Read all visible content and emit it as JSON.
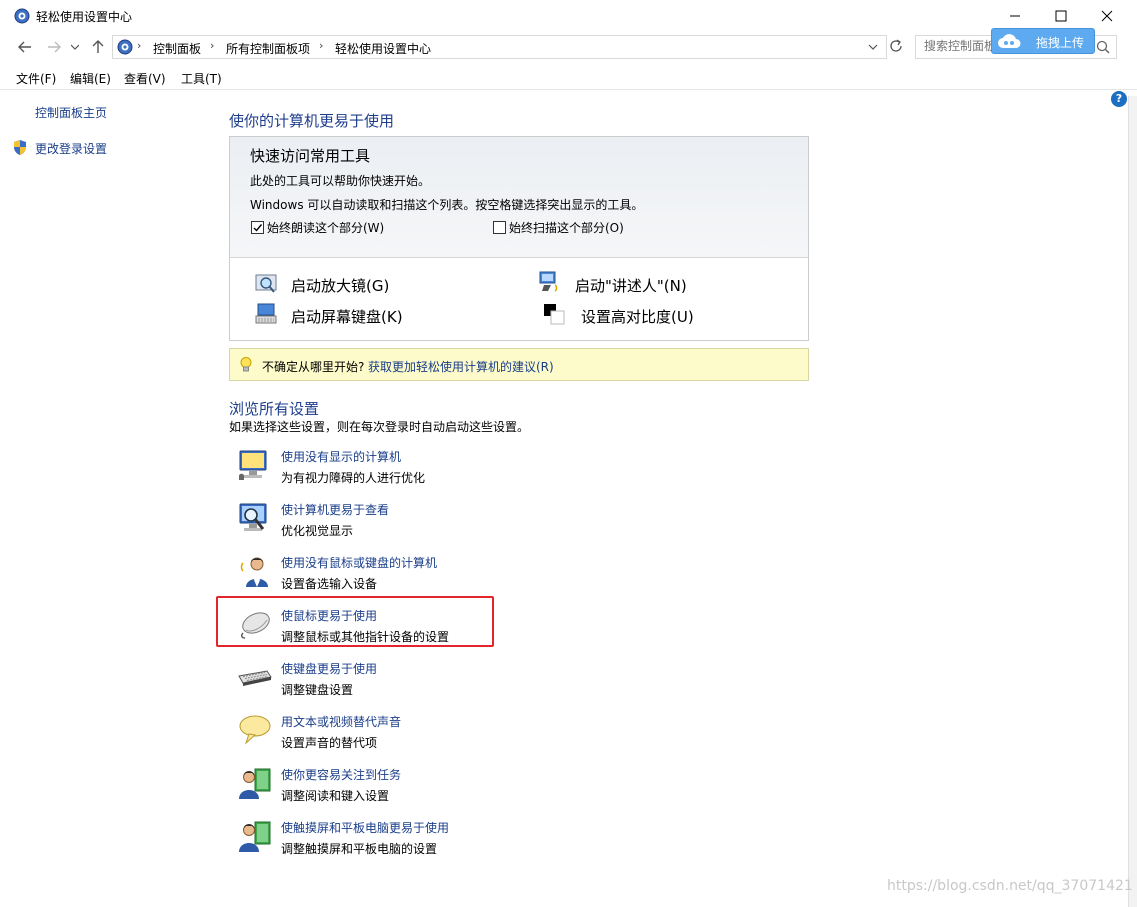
{
  "window": {
    "title": "轻松使用设置中心",
    "controls": [
      "minimize",
      "maximize",
      "close"
    ]
  },
  "address": {
    "breadcrumbs": [
      "控制面板",
      "所有控制面板项",
      "轻松使用设置中心"
    ],
    "search_placeholder": "搜索控制面板"
  },
  "upload_widget": {
    "label": "拖拽上传"
  },
  "menu": [
    {
      "label": "文件(F)"
    },
    {
      "label": "编辑(E)"
    },
    {
      "label": "查看(V)"
    },
    {
      "label": "工具(T)"
    }
  ],
  "sidebar": {
    "home": "控制面板主页",
    "change_login": "更改登录设置"
  },
  "main": {
    "heading": "使你的计算机更易于使用",
    "quick_access": {
      "title": "快速访问常用工具",
      "line1": "此处的工具可以帮助你快速开始。",
      "line2": "Windows 可以自动读取和扫描这个列表。按空格键选择突出显示的工具。",
      "checkbox_read": {
        "label": "始终朗读这个部分(W)",
        "checked": true
      },
      "checkbox_scan": {
        "label": "始终扫描这个部分(O)",
        "checked": false
      },
      "tools": {
        "magnifier": "启动放大镜(G)",
        "narrator": "启动\"讲述人\"(N)",
        "osk": "启动屏幕键盘(K)",
        "contrast": "设置高对比度(U)"
      }
    },
    "tip": {
      "text": "不确定从哪里开始?",
      "link": "获取更加轻松使用计算机的建议(R)"
    },
    "browse": {
      "heading": "浏览所有设置",
      "subtext": "如果选择这些设置，则在每次登录时自动启动这些设置。",
      "items": [
        {
          "link": "使用没有显示的计算机",
          "desc": "为有视力障碍的人进行优化",
          "icon": "monitor-audio-icon"
        },
        {
          "link": "使计算机更易于查看",
          "desc": "优化视觉显示",
          "icon": "monitor-magnifier-icon"
        },
        {
          "link": "使用没有鼠标或键盘的计算机",
          "desc": "设置备选输入设备",
          "icon": "person-speaking-icon"
        },
        {
          "link": "使鼠标更易于使用",
          "desc": "调整鼠标或其他指针设备的设置",
          "icon": "mouse-icon"
        },
        {
          "link": "使键盘更易于使用",
          "desc": "调整键盘设置",
          "icon": "keyboard-icon"
        },
        {
          "link": "用文本或视频替代声音",
          "desc": "设置声音的替代项",
          "icon": "speech-bubble-icon"
        },
        {
          "link": "使你更容易关注到任务",
          "desc": "调整阅读和键入设置",
          "icon": "person-book-icon"
        },
        {
          "link": "使触摸屏和平板电脑更易于使用",
          "desc": "调整触摸屏和平板电脑的设置",
          "icon": "person-tablet-icon"
        }
      ]
    }
  },
  "watermark": "https://blog.csdn.net/qq_37071421",
  "colors": {
    "link": "#1a3e8a",
    "heading": "#1e3e8c",
    "highlight_box": "#e3262b",
    "tip_bg": "#fdfbc9"
  }
}
